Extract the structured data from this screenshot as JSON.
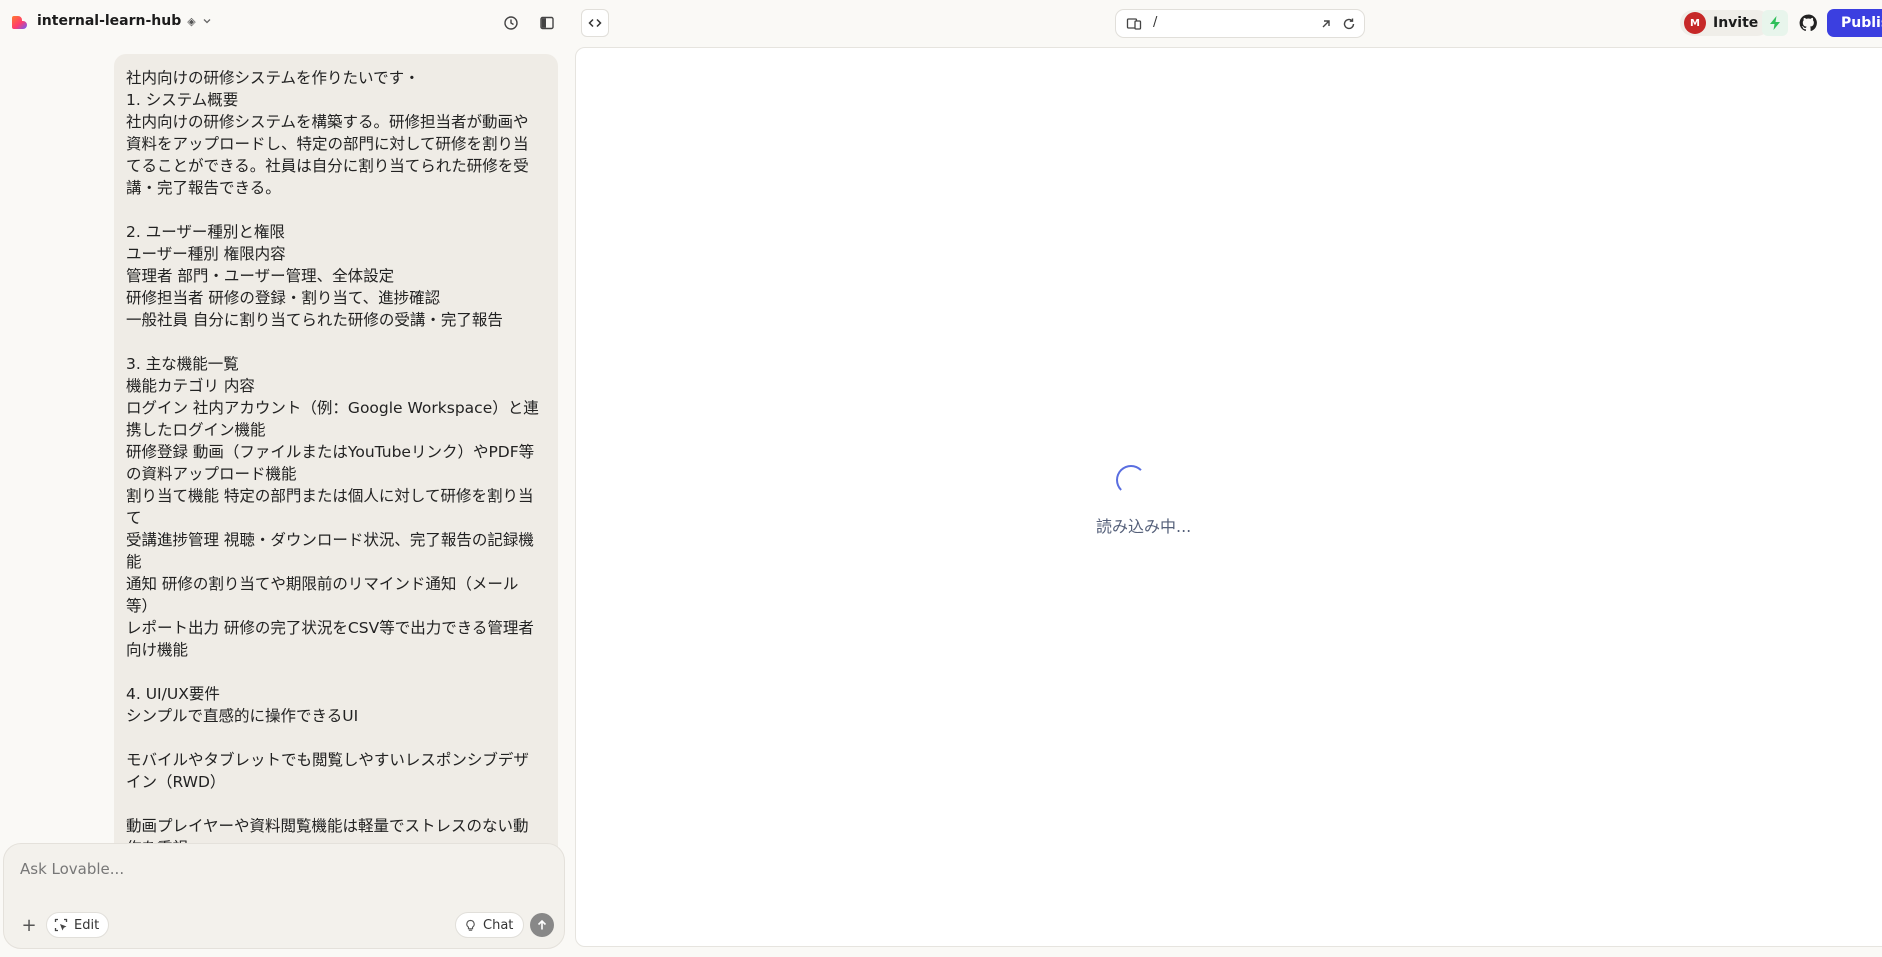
{
  "header": {
    "project_name": "internal-learn-hub",
    "invite_label": "Invite",
    "avatar_initial": "M",
    "publish_label": "Publish",
    "url_path": "/",
    "brand_color": "#3b3fe0"
  },
  "chat": {
    "message_lines": [
      "社内向けの研修システムを作りたいです・",
      "1. システム概要",
      "社内向けの研修システムを構築する。研修担当者が動画や",
      "資料をアップロードし、特定の部門に対して研修を割り当",
      "てることができる。社員は自分に割り当てられた研修を受",
      "講・完了報告できる。",
      "",
      "2. ユーザー種別と権限",
      "ユーザー種別 権限内容",
      "管理者  部門・ユーザー管理、全体設定",
      "研修担当者 研修の登録・割り当て、進捗確認",
      "一般社員  自分に割り当てられた研修の受講・完了報告",
      "",
      "3. 主な機能一覧",
      "機能カテゴリ 内容",
      "ログイン  社内アカウント（例：Google Workspace）と連",
      "携したログイン機能",
      "研修登録  動画（ファイルまたはYouTubeリンク）やPDF等",
      "の資料アップロード機能",
      "割り当て機能 特定の部門または個人に対して研修を割り当",
      "て",
      "受講進捗管理 視聴・ダウンロード状況、完了報告の記録機",
      "能",
      "通知  研修の割り当てや期限前のリマインド通知（メール",
      "等）",
      "レポート出力 研修の完了状況をCSV等で出力できる管理者",
      "向け機能",
      "",
      "4. UI/UX要件",
      "シンプルで直感的に操作できるUI",
      "",
      "モバイルやタブレットでも閲覧しやすいレスポンシブデザ",
      "イン（RWD）",
      "",
      "動画プレイヤーや資料閲覧機能は軽量でストレスのない動",
      "作を重視"
    ],
    "input_placeholder": "Ask Lovable...",
    "edit_label": "Edit",
    "chat_label": "Chat"
  },
  "preview": {
    "loading_text": "読み込み中..."
  }
}
